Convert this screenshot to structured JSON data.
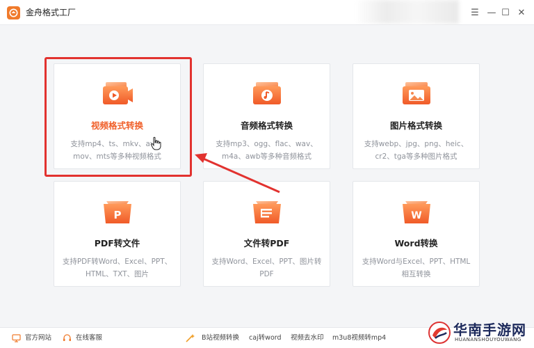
{
  "app": {
    "title": "金舟格式工厂"
  },
  "window_controls": {
    "menu": "☰",
    "minimize": "—",
    "maximize": "☐",
    "close": "✕"
  },
  "cards": [
    {
      "title": "视频格式转换",
      "desc": "支持mp4、ts、mkv、avi、mov、mts等多种视频格式",
      "icon": "video-convert-icon"
    },
    {
      "title": "音频格式转换",
      "desc": "支持mp3、ogg、flac、wav、m4a、awb等多种音频格式",
      "icon": "audio-convert-icon"
    },
    {
      "title": "图片格式转换",
      "desc": "支持webp、jpg、png、heic、cr2、tga等多种图片格式",
      "icon": "image-convert-icon"
    },
    {
      "title": "PDF转文件",
      "desc": "支持PDF转Word、Excel、PPT、HTML、TXT、图片",
      "icon": "pdf-convert-icon",
      "glyph": "P"
    },
    {
      "title": "文件转PDF",
      "desc": "支持Word、Excel、PPT、图片转PDF",
      "icon": "file-to-pdf-icon"
    },
    {
      "title": "Word转换",
      "desc": "支持Word与Excel、PPT、HTML相互转换",
      "icon": "word-convert-icon",
      "glyph": "W"
    }
  ],
  "bottom_bar": {
    "website": "官方网站",
    "support": "在线客服",
    "links": [
      "B站视频转换",
      "caj转word",
      "视频去水印",
      "m3u8视频转mp4"
    ]
  },
  "watermark": {
    "main": "华南手游网",
    "sub": "HUANANSHOUYOUWANG"
  },
  "colors": {
    "accent": "#f0602a",
    "highlight": "#e2322f",
    "icon_gradient_top": "#ff9a5a",
    "icon_gradient_bottom": "#f05a28"
  }
}
